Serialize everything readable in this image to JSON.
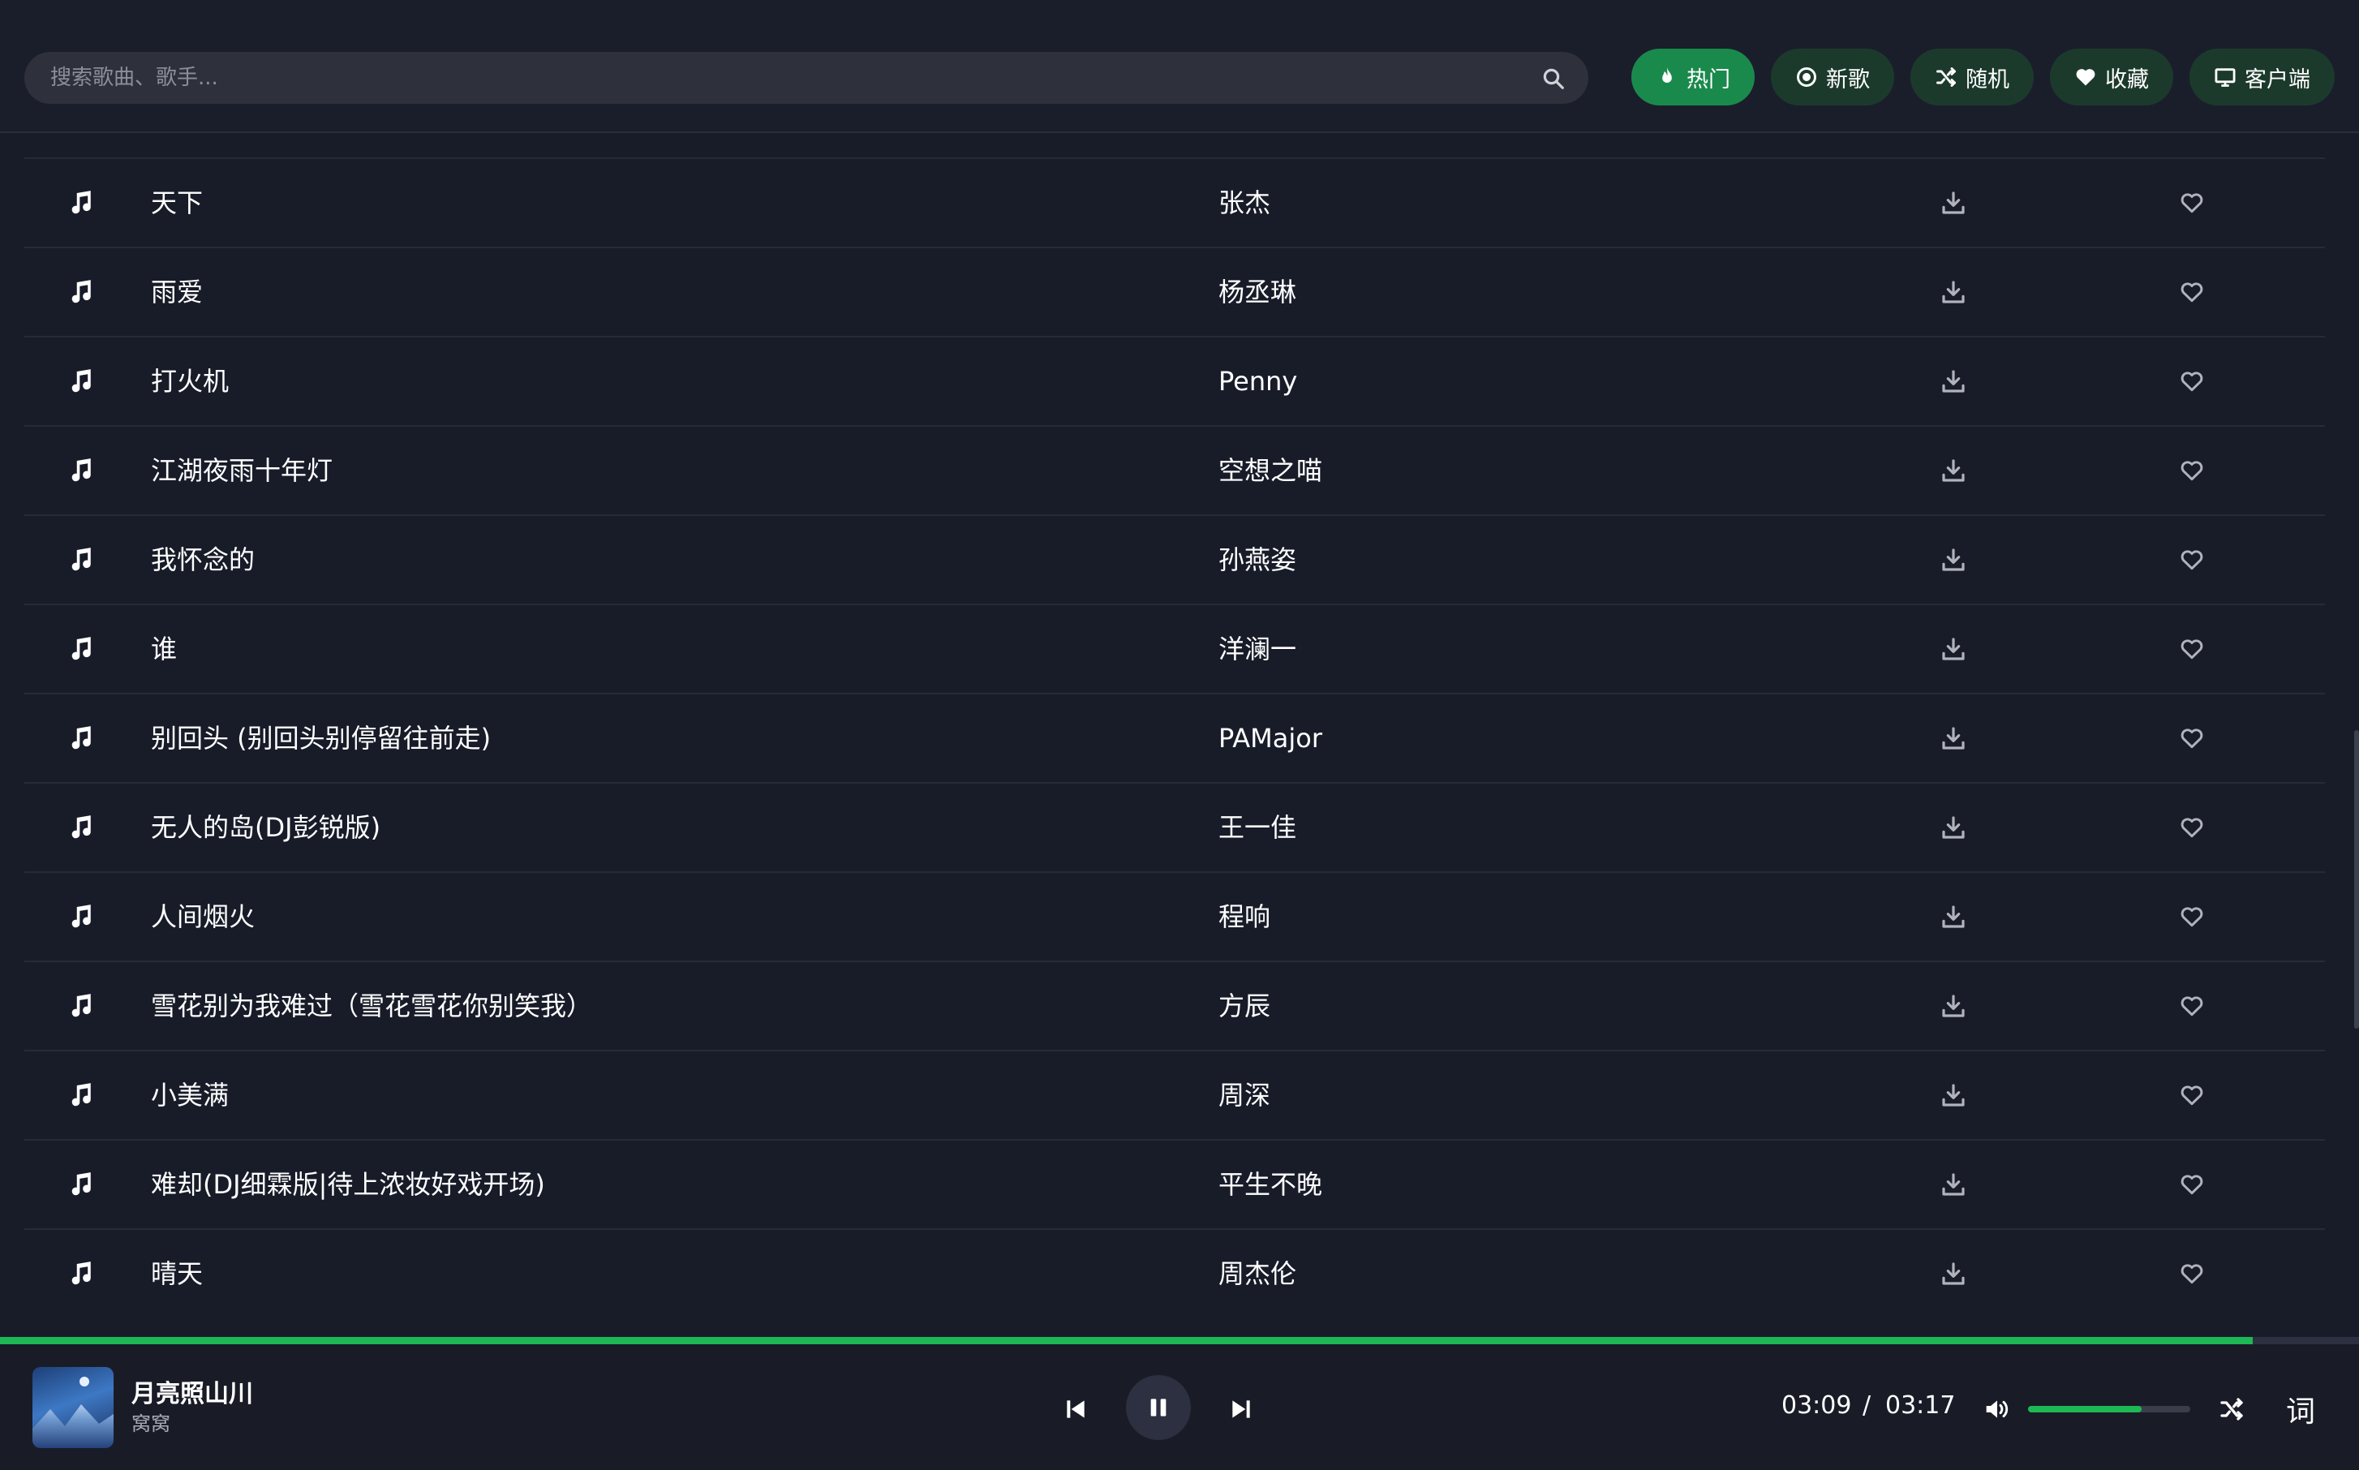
{
  "search": {
    "placeholder": "搜索歌曲、歌手..."
  },
  "nav": [
    {
      "label": "热门",
      "icon": "fire-icon",
      "active": true
    },
    {
      "label": "新歌",
      "icon": "disc-icon",
      "active": false
    },
    {
      "label": "随机",
      "icon": "shuffle-icon",
      "active": false
    },
    {
      "label": "收藏",
      "icon": "heart-icon",
      "active": false
    },
    {
      "label": "客户端",
      "icon": "desktop-icon",
      "active": false
    }
  ],
  "songs": [
    {
      "title": "天下",
      "artist": "张杰"
    },
    {
      "title": "雨爱",
      "artist": "杨丞琳"
    },
    {
      "title": "打火机",
      "artist": "Penny"
    },
    {
      "title": "江湖夜雨十年灯",
      "artist": "空想之喵"
    },
    {
      "title": "我怀念的",
      "artist": "孙燕姿"
    },
    {
      "title": "谁",
      "artist": "洋澜一"
    },
    {
      "title": "别回头 (别回头别停留往前走)",
      "artist": "PAMajor"
    },
    {
      "title": "无人的岛(DJ彭锐版)",
      "artist": "王一佳"
    },
    {
      "title": "人间烟火",
      "artist": "程响"
    },
    {
      "title": "雪花别为我难过（雪花雪花你别笑我）",
      "artist": "方辰"
    },
    {
      "title": "小美满",
      "artist": "周深"
    },
    {
      "title": "难却(DJ细霖版|待上浓妆好戏开场)",
      "artist": "平生不晚"
    },
    {
      "title": "晴天",
      "artist": "周杰伦"
    }
  ],
  "player": {
    "title": "月亮照山川",
    "artist": "窝窝",
    "current_time": "03:09",
    "separator": "/",
    "total_time": "03:17",
    "progress": 0.955,
    "volume": 0.7,
    "lyrics_label": "词"
  },
  "colors": {
    "accent": "#1db954",
    "active_button": "#1a8a4c",
    "button": "#1c3a2c",
    "background": "#181c29"
  }
}
